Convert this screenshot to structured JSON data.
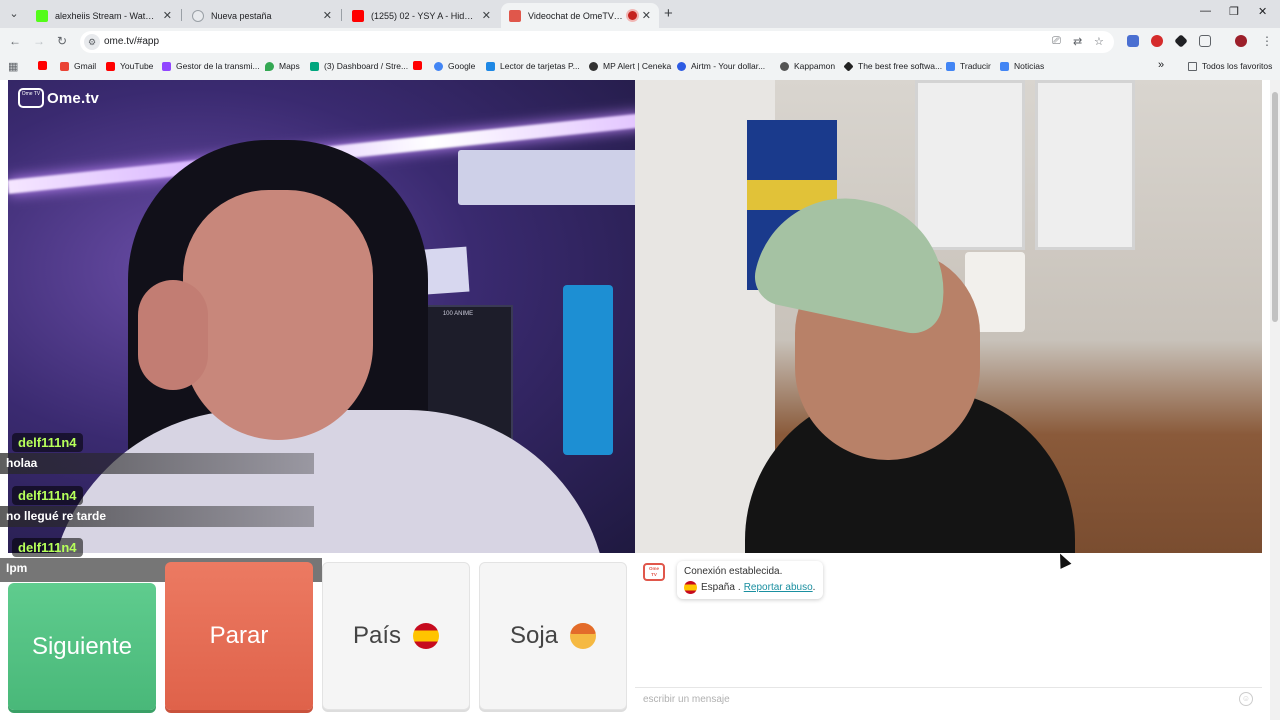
{
  "tabs": [
    {
      "title": "alexheiis Stream - Watch Live o",
      "favicon_color": "#53fc18",
      "active": false
    },
    {
      "title": "Nueva pestaña",
      "favicon_color": "#5f6368",
      "active": false
    },
    {
      "title": "(1255) 02 - YSY A - Hidro | ANT",
      "favicon_color": "#ff0000",
      "active": false
    },
    {
      "title": "Videochat de OmeTV: uno",
      "favicon_color": "#e0574b",
      "active": true,
      "recording": true
    }
  ],
  "address_bar": {
    "url": "ome.tv/#app"
  },
  "bookmarks": {
    "items": [
      {
        "label": "",
        "color": "#ff0000"
      },
      {
        "label": "Gmail",
        "color": "#ea4335"
      },
      {
        "label": "YouTube",
        "color": "#ff0000"
      },
      {
        "label": "Gestor de la transmi...",
        "color": "#9146ff"
      },
      {
        "label": "Maps",
        "color": "#34a853"
      },
      {
        "label": "(3) Dashboard / Stre...",
        "color": "#00a67e"
      },
      {
        "label": "",
        "color": "#ff0000"
      },
      {
        "label": "Google",
        "color": "#4285f4"
      },
      {
        "label": "Lector de tarjetas P...",
        "color": "#1e88e5"
      },
      {
        "label": "MP Alert | Ceneka",
        "color": "#333333"
      },
      {
        "label": "Airtm - Your dollar...",
        "color": "#2d5be3"
      },
      {
        "label": "Kappamon",
        "color": "#555555"
      },
      {
        "label": "The best free softwa...",
        "color": "#222222"
      },
      {
        "label": "Traducir",
        "color": "#4285f4"
      },
      {
        "label": "Noticias",
        "color": "#4285f4"
      }
    ],
    "all_bookmarks": "Todos los favoritos"
  },
  "brand": {
    "logo_text": "Ome.tv",
    "logo_tv": "Ome TV"
  },
  "left_video": {
    "poster_title": "100 ANIME"
  },
  "chat_overlay": [
    {
      "user": "delf111n4",
      "text": "holaa"
    },
    {
      "user": "delf111n4",
      "text": "no llegué re tarde"
    },
    {
      "user": "delf111n4",
      "text": "Ipm"
    }
  ],
  "controls": {
    "next": "Siguiente",
    "stop": "Parar",
    "country": "País",
    "gender": "Soja"
  },
  "chat_panel": {
    "status": "Conexión establecida.",
    "country": "España",
    "separator": ".",
    "report": "Reportar abuso",
    "report_suffix": ".",
    "input_placeholder": "escribir un mensaje"
  },
  "colors": {
    "next": "#52c083",
    "stop": "#e56a52",
    "accent_link": "#1a8fa0",
    "chat_user": "#b6ff5a"
  }
}
